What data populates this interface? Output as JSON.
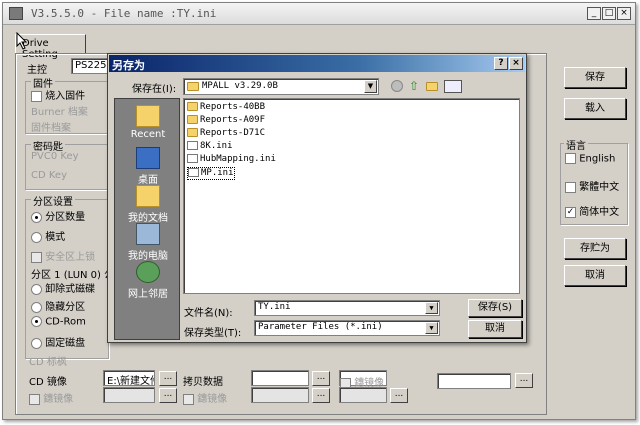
{
  "main_window": {
    "title": "V3.5.5.0 - File name :TY.ini",
    "tab": "Drive Setting",
    "controller_label": "主控",
    "controller_value": "PS2251-0",
    "firmware_group": "固件",
    "burn_firmware": "烧入固件",
    "burner_file": "Burner 档案",
    "firmware_file": "固件档案",
    "password_group": "密码匙",
    "pvc0_key": "PVC0 Key",
    "cd_key": "CD Key",
    "partition_group": "分区设置",
    "partition_count": "分区数量",
    "mode": "模式",
    "safe_lock": "安全区上锁",
    "partition1": "分区 1 (LUN 0) 公用",
    "removable": "卸除式磁碟",
    "hidden": "隐藏分区",
    "cdrom": "CD-Rom",
    "fixed_disk": "固定磁盘",
    "cd_label": "CD 标枫",
    "cd_image": "CD 镜像",
    "cd_image_value": "E:\\新建文件",
    "mirror1": "鏸镜像",
    "copy_data": "拷贝数据",
    "mirror2": "鏸镜像",
    "mirror3": "鏸镜像",
    "save_button": "保存",
    "load_button": "载入",
    "language_group": "语言",
    "lang_english": "English",
    "lang_traditional": "繁體中文",
    "lang_simplified": "简体中文",
    "save_as_button": "存贮为",
    "cancel_button": "取消"
  },
  "dialog": {
    "title": "另存为",
    "save_in_label": "保存在(I):",
    "save_in_value": "MPALL v3.29.0B",
    "places": [
      {
        "label": "Recent"
      },
      {
        "label": "桌面"
      },
      {
        "label": "我的文档"
      },
      {
        "label": "我的电脑"
      },
      {
        "label": "网上邻居"
      }
    ],
    "files": [
      {
        "name": "Reports-40BB",
        "kind": "folder"
      },
      {
        "name": "Reports-A09F",
        "kind": "folder"
      },
      {
        "name": "Reports-D71C",
        "kind": "folder"
      },
      {
        "name": "8K.ini",
        "kind": "file"
      },
      {
        "name": "HubMapping.ini",
        "kind": "file"
      },
      {
        "name": "MP.ini",
        "kind": "file"
      }
    ],
    "filename_label": "文件名(N):",
    "filename_value": "TY.ini",
    "filetype_label": "保存类型(T):",
    "filetype_value": "Parameter Files (*.ini)",
    "save_button": "保存(S)",
    "cancel_button": "取消"
  }
}
